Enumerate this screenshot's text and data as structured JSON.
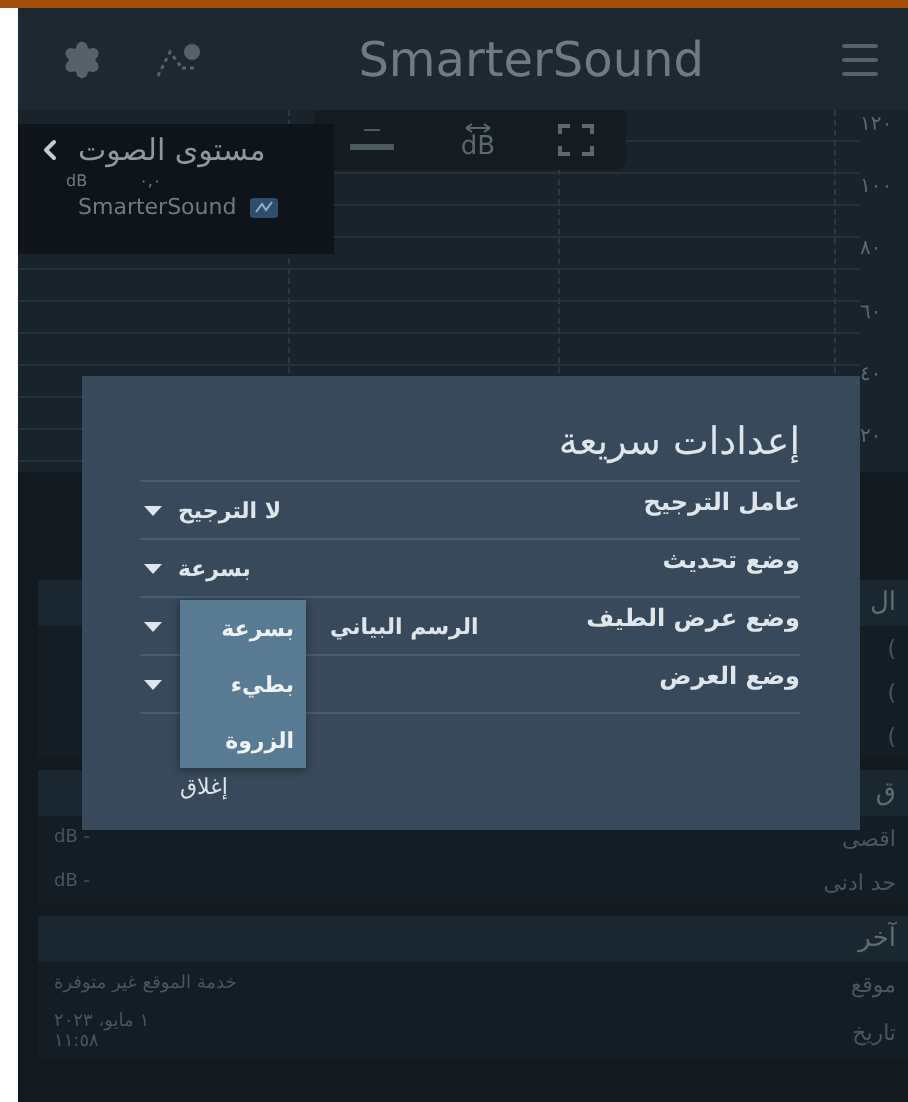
{
  "app_bar": {
    "title": "SmarterSound"
  },
  "chart_toolbar": {
    "unit": "dB"
  },
  "level_widget": {
    "title": "مستوى الصوت",
    "unit": "dB",
    "value": "٠,٠",
    "brand": "SmarterSound"
  },
  "chart": {
    "y_labels": [
      "١٢٠",
      "١٠٠",
      "٨٠",
      "٦٠",
      "٤٠",
      "٢٠"
    ]
  },
  "sections": [
    {
      "header": "ال",
      "rows": [
        {
          "label": "("
        },
        {
          "label": "("
        },
        {
          "label": "("
        }
      ]
    },
    {
      "header": "ق",
      "rows": [
        {
          "label": "اقصى",
          "value_lines": [
            "dB -"
          ]
        },
        {
          "label": "حد ادنى",
          "value_lines": [
            "dB -"
          ]
        }
      ]
    },
    {
      "header": "آخر",
      "rows": [
        {
          "label": "موقع",
          "value_lines": [
            "خدمة الموقع غير متوفرة"
          ]
        },
        {
          "label": "تاريخ",
          "value_lines": [
            "١ مايو، ٢٠٢٣",
            "١١:٥٨"
          ]
        }
      ]
    }
  ],
  "dialog": {
    "title": "إعدادات سريعة",
    "rows": [
      {
        "label": "عامل الترجيح",
        "value": "لا الترجيح",
        "open": false
      },
      {
        "label": "وضع تحديث",
        "value": "بسرعة",
        "open": false
      },
      {
        "label": "وضع عرض الطيف",
        "value": "الرسم البياني",
        "open": true
      },
      {
        "label": "وضع العرض",
        "open": false
      }
    ],
    "close": "إغلاق"
  },
  "dropdown": {
    "options": [
      "بسرعة",
      "بطيء",
      "الزروة"
    ]
  }
}
